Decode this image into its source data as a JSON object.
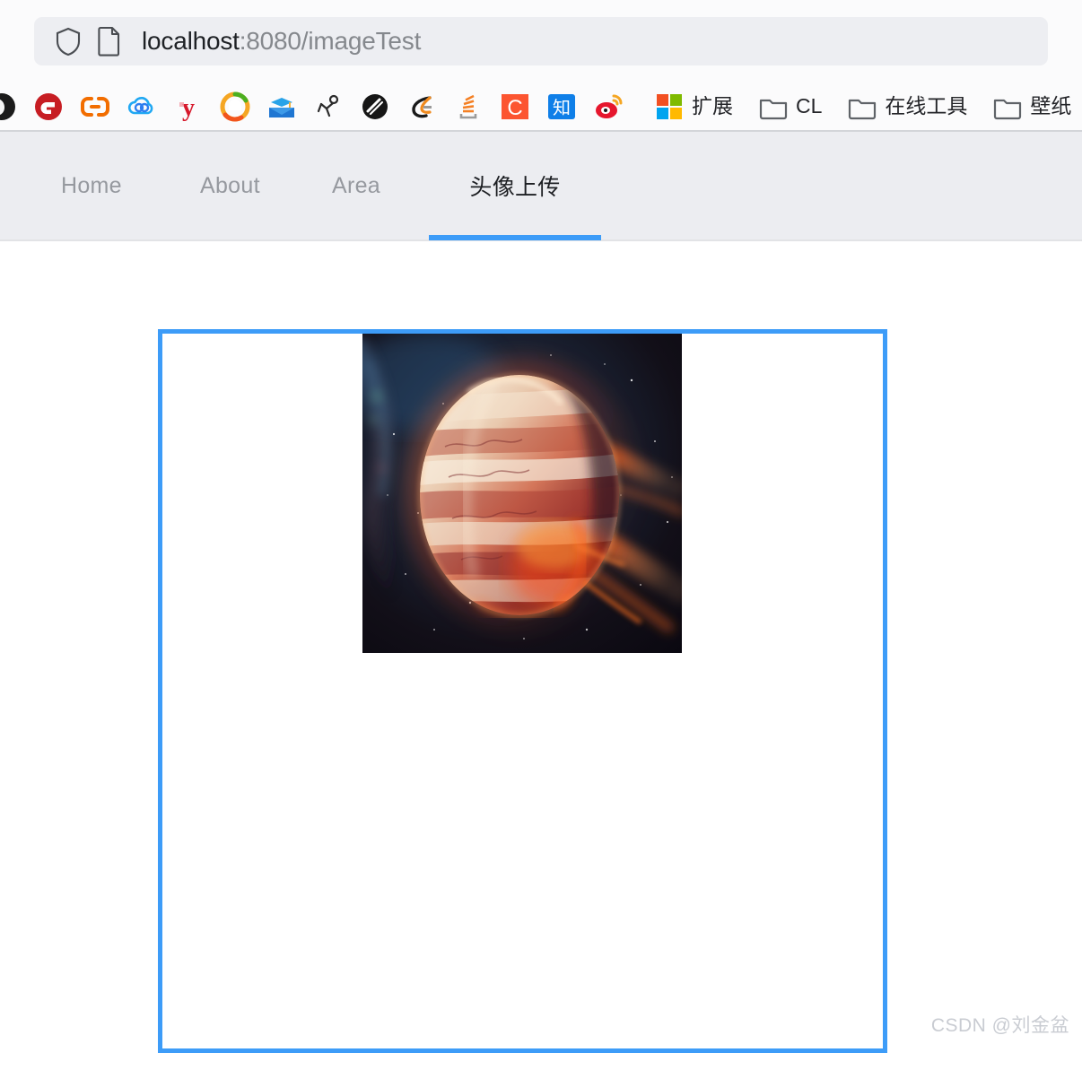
{
  "browser": {
    "url_pill": {
      "shield_icon": "shield-icon",
      "page_icon": "page-document-icon",
      "url_host": "localhost",
      "url_rest": ":8080/imageTest",
      "url_full": "localhost:8080/imageTest"
    },
    "bookmarks": [
      {
        "icon": "dark-circle-icon",
        "label": "",
        "clipped": true
      },
      {
        "icon": "gitee-icon",
        "label": ""
      },
      {
        "icon": "orange-link-icon",
        "label": ""
      },
      {
        "icon": "baidu-cloud-icon",
        "label": ""
      },
      {
        "icon": "youdao-icon",
        "label": ""
      },
      {
        "icon": "qq-browser-icon",
        "label": ""
      },
      {
        "icon": "mail-graduation-icon",
        "label": ""
      },
      {
        "icon": "runner-icon",
        "label": ""
      },
      {
        "icon": "black-sphere-icon",
        "label": ""
      },
      {
        "icon": "eleme-icon",
        "label": ""
      },
      {
        "icon": "stackoverflow-icon",
        "label": ""
      },
      {
        "icon": "csdn-icon",
        "label": ""
      },
      {
        "icon": "zhihu-icon",
        "label": ""
      },
      {
        "icon": "weibo-icon",
        "label": ""
      },
      {
        "icon": "microsoft-icon",
        "label": "扩展"
      },
      {
        "icon": "folder-icon",
        "label": "CL"
      },
      {
        "icon": "folder-icon",
        "label": "在线工具"
      },
      {
        "icon": "folder-icon",
        "label": "壁纸"
      }
    ]
  },
  "page": {
    "nav_tabs": [
      {
        "label": "Home",
        "active": false
      },
      {
        "label": "About",
        "active": false
      },
      {
        "label": "Area",
        "active": false
      },
      {
        "label": "头像上传",
        "active": true
      }
    ],
    "upload": {
      "box_label": "image-preview-box",
      "preview_alt": "fiery-gas-giant-planet"
    },
    "watermark": "CSDN @刘金盆"
  },
  "colors": {
    "accent": "#3d9cf8",
    "nav_bg": "#ecedf1",
    "chrome_bg": "#fbfbfc",
    "url_pill_bg": "#edeef2",
    "tab_inactive": "#96999f",
    "tab_active": "#1d1f23",
    "watermark": "#c9ccd2"
  }
}
